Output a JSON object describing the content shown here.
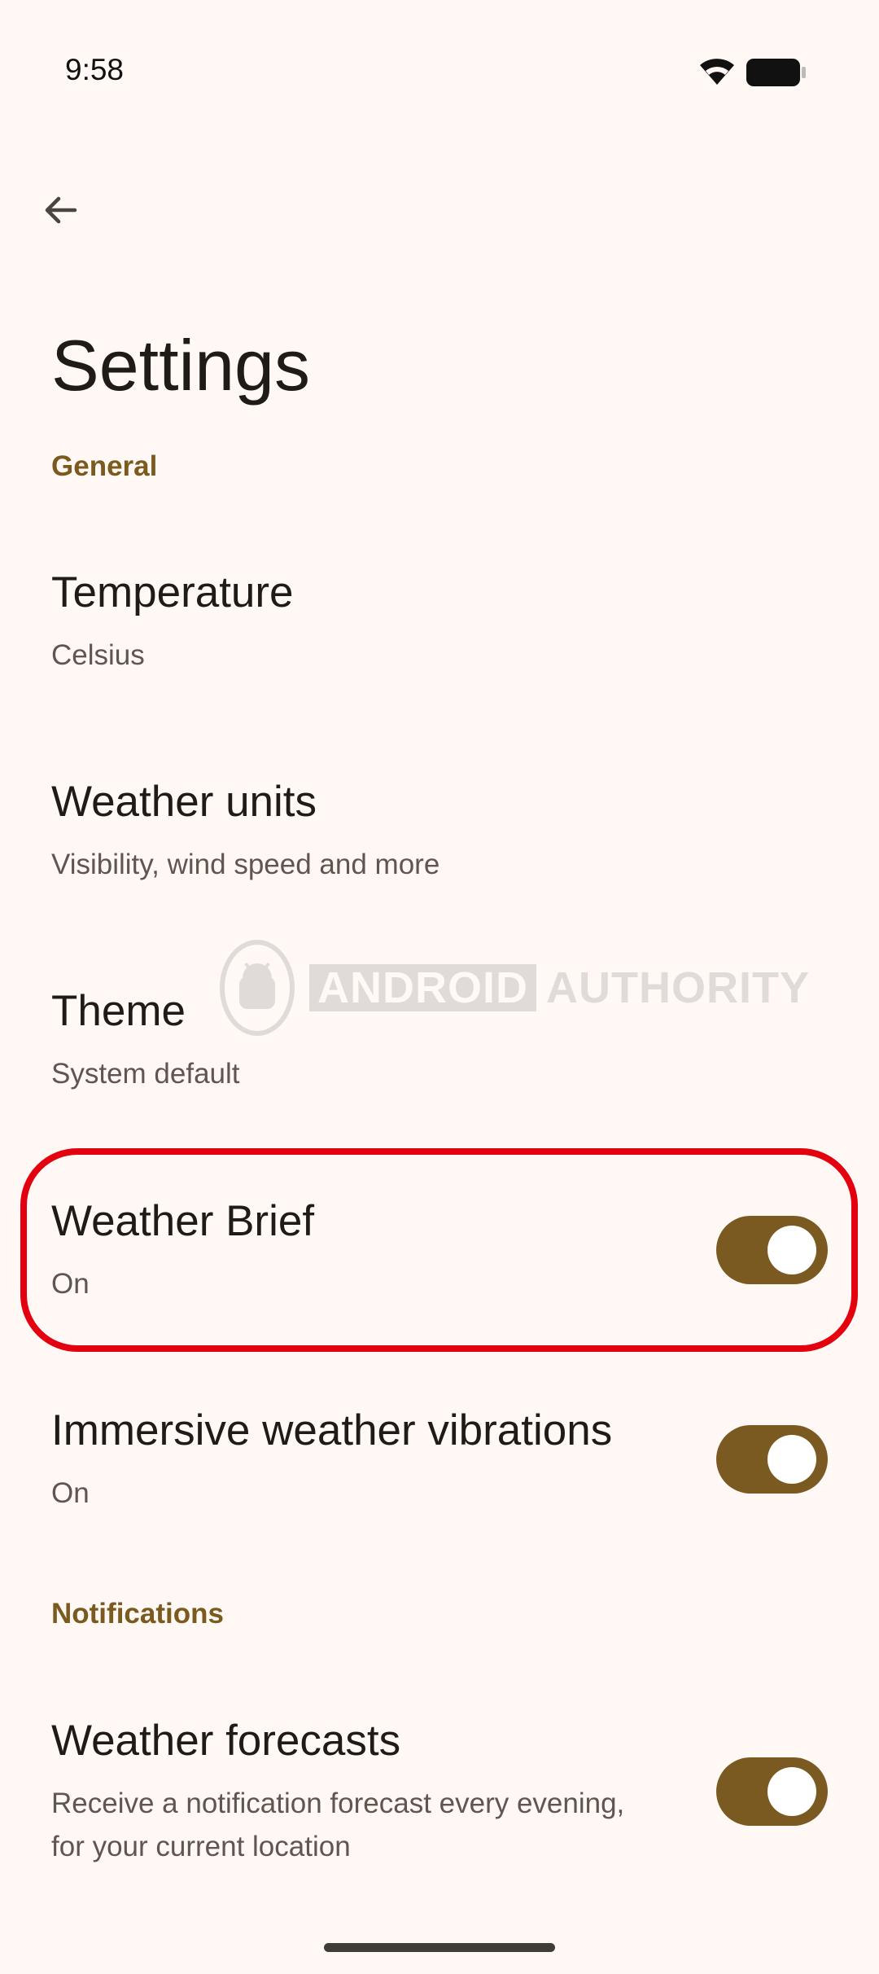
{
  "status_bar": {
    "time": "9:58",
    "icons": [
      "wifi-icon",
      "battery-icon"
    ]
  },
  "header": {
    "back_icon": "arrow-left-icon",
    "title": "Settings"
  },
  "sections": {
    "general": {
      "label": "General",
      "items": [
        {
          "title": "Temperature",
          "subtitle": "Celsius"
        },
        {
          "title": "Weather units",
          "subtitle": "Visibility, wind speed and more"
        },
        {
          "title": "Theme",
          "subtitle": "System default"
        },
        {
          "title": "Weather Brief",
          "subtitle": "On",
          "toggle_on": true
        },
        {
          "title": "Immersive weather vibrations",
          "subtitle": "On",
          "toggle_on": true
        }
      ]
    },
    "notifications": {
      "label": "Notifications",
      "items": [
        {
          "title": "Weather forecasts",
          "subtitle_line1": "Receive a notification forecast every evening,",
          "subtitle_line2": "for your current location",
          "toggle_on": true
        }
      ]
    }
  },
  "watermark": {
    "brand_part1": "ANDROID",
    "brand_part2": "AUTHORITY"
  },
  "colors": {
    "background": "#FFF8F4",
    "accent": "#7B5A22",
    "section_header": "#7A5A1F",
    "highlight": "#E3000F"
  }
}
